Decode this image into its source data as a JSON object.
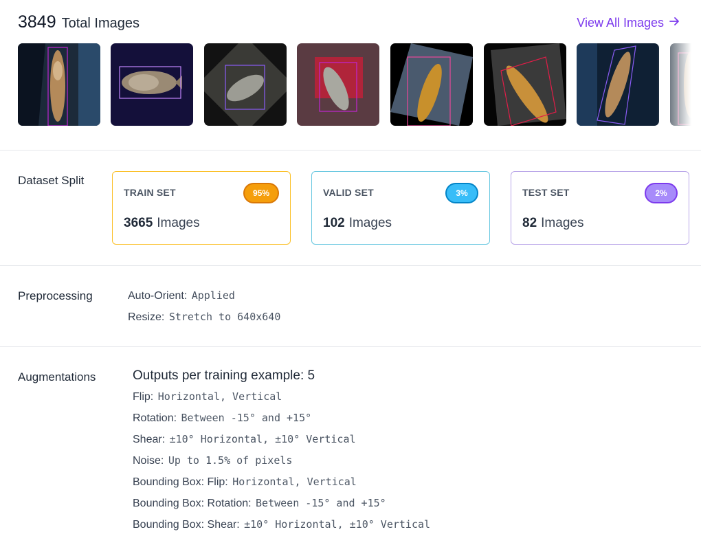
{
  "header": {
    "total_count": "3849",
    "total_label": "Total Images",
    "view_all_label": "View All Images"
  },
  "thumbnails": [
    {
      "alt": "fish image 1"
    },
    {
      "alt": "fish image 2"
    },
    {
      "alt": "fish image 3"
    },
    {
      "alt": "fish image 4"
    },
    {
      "alt": "fish image 5"
    },
    {
      "alt": "fish image 6"
    },
    {
      "alt": "fish image 7"
    },
    {
      "alt": "fish image 8"
    }
  ],
  "dataset_split": {
    "label": "Dataset Split",
    "unit": "Images",
    "cards": [
      {
        "title": "TRAIN SET",
        "count": "3665",
        "badge": "95%",
        "color": "#f59e0b",
        "badge_border": "#d97706"
      },
      {
        "title": "VALID SET",
        "count": "102",
        "badge": "3%",
        "color": "#38bdf8",
        "badge_border": "#0284c7"
      },
      {
        "title": "TEST SET",
        "count": "82",
        "badge": "2%",
        "color": "#a78bfa",
        "badge_border": "#7c3aed"
      }
    ]
  },
  "preprocessing": {
    "label": "Preprocessing",
    "items": [
      {
        "key": "Auto-Orient:",
        "value": "Applied"
      },
      {
        "key": "Resize:",
        "value": "Stretch to 640x640"
      }
    ]
  },
  "augmentations": {
    "label": "Augmentations",
    "outputs": "Outputs per training example: 5",
    "items": [
      {
        "key": "Flip:",
        "value": "Horizontal, Vertical"
      },
      {
        "key": "Rotation:",
        "value": "Between -15° and +15°"
      },
      {
        "key": "Shear:",
        "value": "±10° Horizontal, ±10° Vertical"
      },
      {
        "key": "Noise:",
        "value": "Up to 1.5% of pixels"
      },
      {
        "key": "Bounding Box: Flip:",
        "value": "Horizontal, Vertical"
      },
      {
        "key": "Bounding Box: Rotation:",
        "value": "Between -15° and +15°"
      },
      {
        "key": "Bounding Box: Shear:",
        "value": "±10° Horizontal, ±10° Vertical"
      }
    ]
  },
  "colors": {
    "accent": "#7c3aed",
    "divider": "#e5e7eb"
  }
}
